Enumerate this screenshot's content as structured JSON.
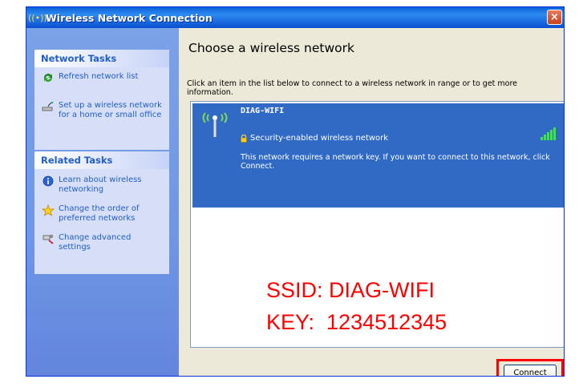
{
  "window": {
    "title": "Wireless Network Connection",
    "close_label": "×"
  },
  "left": {
    "network_tasks": {
      "title": "Network Tasks",
      "items": [
        {
          "label": "Refresh network list",
          "icon": "refresh-icon"
        },
        {
          "label": "Set up a wireless network for a home or small office",
          "icon": "setup-wizard-icon"
        }
      ]
    },
    "related_tasks": {
      "title": "Related Tasks",
      "items": [
        {
          "label": "Learn about wireless networking",
          "icon": "info-icon"
        },
        {
          "label": "Change the order of preferred networks",
          "icon": "star-icon"
        },
        {
          "label": "Change advanced settings",
          "icon": "settings-icon"
        }
      ]
    }
  },
  "main": {
    "heading": "Choose a wireless network",
    "instructions": "Click an item in the list below to connect to a wireless network in range or to get more information.",
    "network": {
      "ssid": "DIAG-WIFI",
      "security": "Security-enabled wireless network",
      "description": "This network requires a network key. If you want to connect to this network, click Connect.",
      "signal_bars": 5
    },
    "overlay": {
      "ssid_line": "SSID: DIAG-WIFI",
      "key_line": "KEY:  1234512345"
    },
    "connect_label": "Connect"
  },
  "colors": {
    "selection": "#316ac5",
    "overlay_text": "#ff0000",
    "left_pane": "#6e97e4"
  }
}
